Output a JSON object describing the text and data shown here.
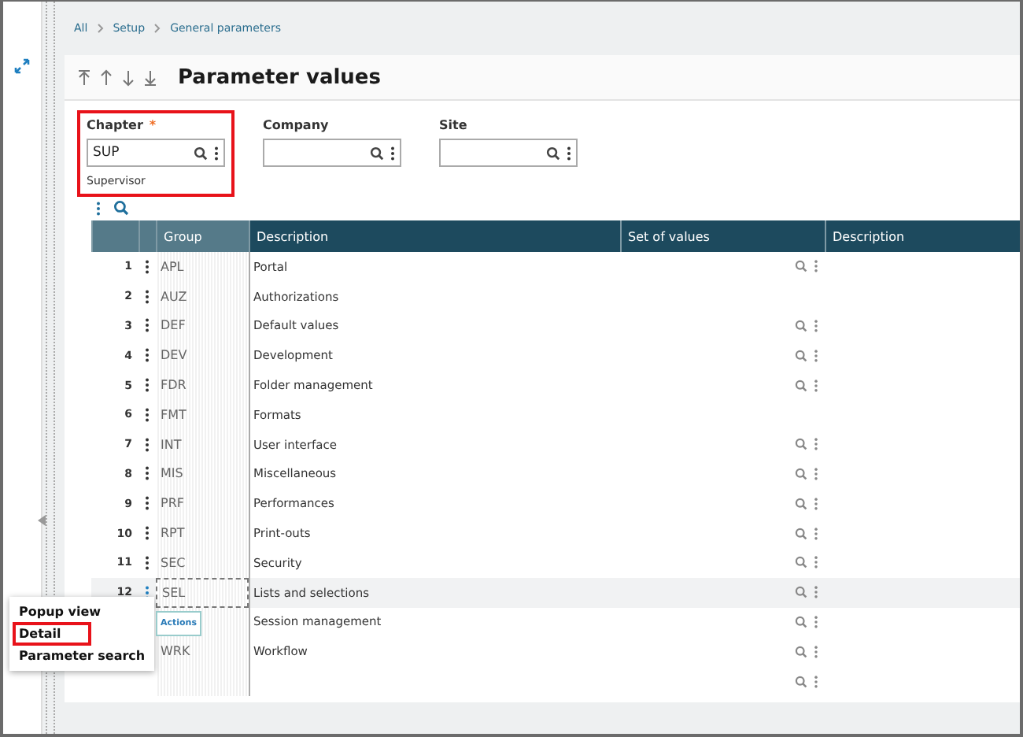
{
  "breadcrumb": [
    "All",
    "Setup",
    "General parameters"
  ],
  "title": "Parameter values",
  "fields": [
    {
      "label": "Chapter",
      "marker": "*",
      "value": "SUP",
      "caption": "Supervisor",
      "highlighted": true
    },
    {
      "label": "Company",
      "highlighted": false
    },
    {
      "label": "Site",
      "highlighted": false
    }
  ],
  "table": {
    "columns": [
      "Group",
      "Description",
      "Set of values",
      "Description"
    ],
    "rows": [
      {
        "number": "1",
        "group": "APL",
        "description": "Portal",
        "lookup": true,
        "selected": false
      },
      {
        "number": "2",
        "group": "AUZ",
        "description": "Authorizations",
        "lookup": false,
        "selected": false
      },
      {
        "number": "3",
        "group": "DEF",
        "description": "Default values",
        "lookup": true,
        "selected": false
      },
      {
        "number": "4",
        "group": "DEV",
        "description": "Development",
        "lookup": true,
        "selected": false
      },
      {
        "number": "5",
        "group": "FDR",
        "description": "Folder management",
        "lookup": true,
        "selected": false
      },
      {
        "number": "6",
        "group": "FMT",
        "description": "Formats",
        "lookup": false,
        "selected": false
      },
      {
        "number": "7",
        "group": "INT",
        "description": "User interface",
        "lookup": true,
        "selected": false
      },
      {
        "number": "8",
        "group": "MIS",
        "description": "Miscellaneous",
        "lookup": true,
        "selected": false
      },
      {
        "number": "9",
        "group": "PRF",
        "description": "Performances",
        "lookup": true,
        "selected": false
      },
      {
        "number": "10",
        "group": "RPT",
        "description": "Print-outs",
        "lookup": true,
        "selected": false
      },
      {
        "number": "11",
        "group": "SEC",
        "description": "Security",
        "lookup": true,
        "selected": false
      },
      {
        "number": "12",
        "group": "SEL",
        "description": "Lists and selections",
        "lookup": true,
        "selected": true
      },
      {
        "description": "Session management",
        "lookup": true,
        "selected": false
      },
      {
        "group": "WRK",
        "description": "Workflow",
        "lookup": true,
        "selected": false
      },
      {
        "lookup": true,
        "selected": false
      }
    ]
  },
  "tooltip": "Actions",
  "menu": [
    {
      "label": "Popup view",
      "highlighted": false
    },
    {
      "label": "Detail",
      "highlighted": true
    },
    {
      "label": "Parameter search",
      "highlighted": false
    }
  ]
}
